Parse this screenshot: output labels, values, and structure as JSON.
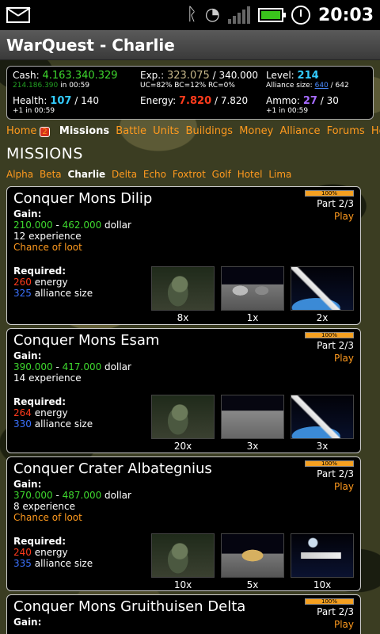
{
  "status_bar": {
    "time": "20:03",
    "icons": [
      "mail-icon",
      "bluetooth-icon",
      "wifi-icon",
      "signal-icon",
      "battery-icon",
      "alarm-icon"
    ],
    "battery_color": "#3ac41c"
  },
  "app": {
    "title": "WarQuest - Charlie"
  },
  "stats": {
    "cash_label": "Cash:",
    "cash_value": "4.163.340.329",
    "cash_sub_value": "214.186.390",
    "cash_sub_text": " in 00:59",
    "health_label": "Health:",
    "health_value": "107",
    "health_max": " / 140",
    "health_sub": "+1 in 00:59",
    "exp_label": "Exp.:",
    "exp_value": "323.075",
    "exp_max": " / 340.000",
    "exp_sub": "UC=82% BC=12% RC=0%",
    "energy_label": "Energy:",
    "energy_value": "7.820",
    "energy_max": " / 7.820",
    "level_label": "Level:",
    "level_value": "214",
    "alliance_label": "Alliance size:",
    "alliance_value": "640",
    "alliance_max": " / 642",
    "ammo_label": "Ammo:",
    "ammo_value": "27",
    "ammo_max": " / 30",
    "ammo_sub": "+1 in 00:59"
  },
  "nav": {
    "items": [
      "Home",
      "Missions",
      "Battle",
      "Units",
      "Buildings",
      "Money",
      "Alliance",
      "Forums",
      "Help"
    ],
    "home_badge": "2",
    "active": "Missions"
  },
  "section_title": "MISSIONS",
  "planets": {
    "items": [
      "Alpha",
      "Beta",
      "Charlie",
      "Delta",
      "Echo",
      "Foxtrot",
      "Golf",
      "Hotel",
      "Lima"
    ],
    "active": "Charlie"
  },
  "missions": [
    {
      "title": "Conquer Mons Dilip",
      "gain_label": "Gain:",
      "dollar_min": "210.000",
      "dollar_max": "462.000",
      "dollar_unit": "dollar",
      "experience": "12",
      "experience_unit": "experience",
      "loot": "Chance of loot",
      "progress_label": "100%",
      "progress": 1.0,
      "part": "Part 2/3",
      "play": "Play",
      "required_label": "Required:",
      "energy": "260",
      "energy_unit": "energy",
      "alliance": "325",
      "alliance_unit": "alliance size",
      "units": [
        {
          "image": "mech-unit-image",
          "count": "8x"
        },
        {
          "image": "rover-unit-image",
          "count": "1x"
        },
        {
          "image": "spaceship-unit-image",
          "count": "2x"
        }
      ]
    },
    {
      "title": "Conquer Mons Esam",
      "gain_label": "Gain:",
      "dollar_min": "390.000",
      "dollar_max": "417.000",
      "dollar_unit": "dollar",
      "experience": "14",
      "experience_unit": "experience",
      "loot": "",
      "progress_label": "100%",
      "progress": 1.0,
      "part": "Part 2/3",
      "play": "Play",
      "required_label": "Required:",
      "energy": "264",
      "energy_unit": "energy",
      "alliance": "330",
      "alliance_unit": "alliance size",
      "units": [
        {
          "image": "mech-unit-image",
          "count": "20x"
        },
        {
          "image": "crawler-unit-image",
          "count": "3x"
        },
        {
          "image": "spaceship-unit-image",
          "count": "3x"
        }
      ]
    },
    {
      "title": "Conquer Crater Albategnius",
      "gain_label": "Gain:",
      "dollar_min": "370.000",
      "dollar_max": "487.000",
      "dollar_unit": "dollar",
      "experience": "8",
      "experience_unit": "experience",
      "loot": "Chance of loot",
      "progress_label": "100%",
      "progress": 1.0,
      "part": "Part 2/3",
      "play": "Play",
      "required_label": "Required:",
      "energy": "240",
      "energy_unit": "energy",
      "alliance": "335",
      "alliance_unit": "alliance size",
      "units": [
        {
          "image": "mech-unit-image",
          "count": "10x"
        },
        {
          "image": "buggy-unit-image",
          "count": "5x"
        },
        {
          "image": "spaceship-unit-image",
          "count": "10x"
        }
      ]
    },
    {
      "title": "Conquer Mons Gruithuisen Delta",
      "gain_label": "Gain:",
      "progress_label": "100%",
      "progress": 1.0,
      "part": "Part 2/3",
      "play": "Play"
    }
  ]
}
